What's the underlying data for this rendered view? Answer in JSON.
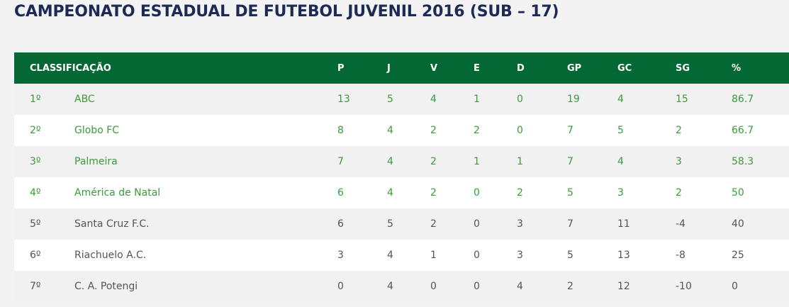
{
  "page": {
    "title": "CAMPEONATO ESTADUAL DE FUTEBOL JUVENIL 2016 (SUB – 17)"
  },
  "table": {
    "headers": [
      "CLASSIFICAÇÃO",
      "P",
      "J",
      "V",
      "E",
      "D",
      "GP",
      "GC",
      "SG",
      "%"
    ],
    "rows": [
      {
        "pos": "1º",
        "team": "ABC",
        "p": "13",
        "j": "5",
        "v": "4",
        "e": "1",
        "d": "0",
        "gp": "19",
        "gc": "4",
        "sg": "15",
        "pct": "86.7"
      },
      {
        "pos": "2º",
        "team": "Globo FC",
        "p": "8",
        "j": "4",
        "v": "2",
        "e": "2",
        "d": "0",
        "gp": "7",
        "gc": "5",
        "sg": "2",
        "pct": "66.7"
      },
      {
        "pos": "3º",
        "team": "Palmeira",
        "p": "7",
        "j": "4",
        "v": "2",
        "e": "1",
        "d": "1",
        "gp": "7",
        "gc": "4",
        "sg": "3",
        "pct": "58.3"
      },
      {
        "pos": "4º",
        "team": "América de Natal",
        "p": "6",
        "j": "4",
        "v": "2",
        "e": "0",
        "d": "2",
        "gp": "5",
        "gc": "3",
        "sg": "2",
        "pct": "50"
      },
      {
        "pos": "5º",
        "team": "Santa Cruz F.C.",
        "p": "6",
        "j": "5",
        "v": "2",
        "e": "0",
        "d": "3",
        "gp": "7",
        "gc": "11",
        "sg": "-4",
        "pct": "40"
      },
      {
        "pos": "6º",
        "team": "Riachuelo A.C.",
        "p": "3",
        "j": "4",
        "v": "1",
        "e": "0",
        "d": "3",
        "gp": "5",
        "gc": "13",
        "sg": "-8",
        "pct": "25"
      },
      {
        "pos": "7º",
        "team": "C. A. Potengi",
        "p": "0",
        "j": "4",
        "v": "0",
        "e": "0",
        "d": "4",
        "gp": "2",
        "gc": "12",
        "sg": "-10",
        "pct": "0"
      }
    ]
  },
  "colors": {
    "title": "#1b2b55",
    "header_bg": "#046835",
    "qualified_text": "#3a9b3a",
    "other_text": "#555555"
  }
}
